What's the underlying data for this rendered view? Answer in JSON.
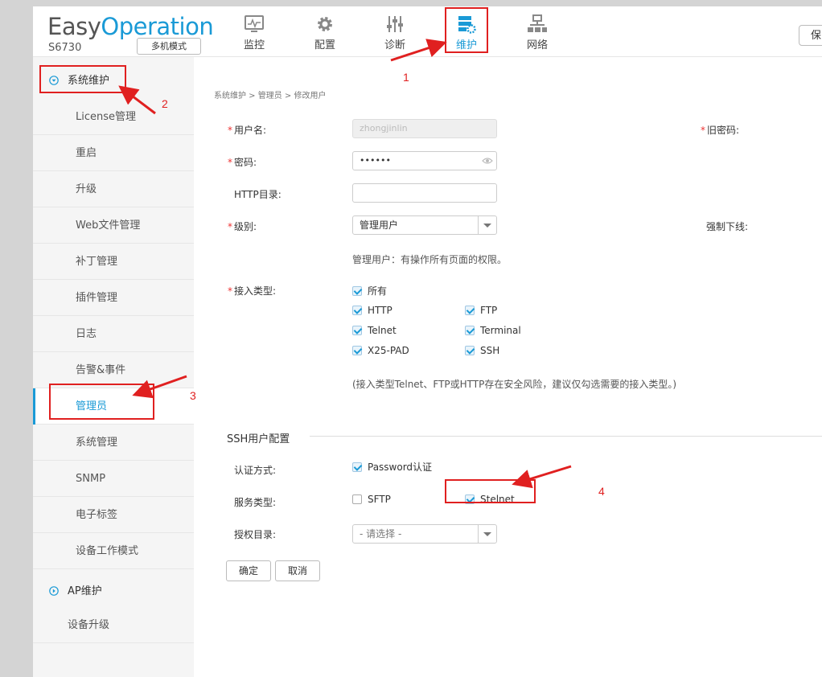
{
  "header": {
    "logo_easy": "Easy",
    "logo_operation": "Operation",
    "model": "S6730",
    "mode_button": "多机模式",
    "nav": [
      {
        "label": "监控",
        "icon": "monitor-icon"
      },
      {
        "label": "配置",
        "icon": "gear-icon"
      },
      {
        "label": "诊断",
        "icon": "diagnose-sliders-icon"
      },
      {
        "label": "维护",
        "icon": "maintenance-server-icon",
        "active": true
      },
      {
        "label": "网络",
        "icon": "network-topology-icon"
      }
    ],
    "save_button": "保"
  },
  "sidebar": {
    "group_system": "系统维护",
    "items": [
      "License管理",
      "重启",
      "升级",
      "Web文件管理",
      "补丁管理",
      "插件管理",
      "日志",
      "告警&事件",
      "管理员",
      "系统管理",
      "SNMP",
      "电子标签",
      "设备工作模式"
    ],
    "active_item": "管理员",
    "group_ap": "AP维护",
    "device_upgrade": "设备升级"
  },
  "breadcrumb": "系统维护 > 管理员 > 修改用户",
  "form": {
    "username_label": "用户名:",
    "username_value": "zhongjinlin",
    "old_password_label": "旧密码:",
    "password_label": "密码:",
    "password_value": "••••••",
    "http_dir_label": "HTTP目录:",
    "http_dir_value": "",
    "level_label": "级别:",
    "level_value": "管理用户",
    "force_offline_label": "强制下线:",
    "level_hint": "管理用户：有操作所有页面的权限。",
    "access_type_label": "接入类型:",
    "access_types": [
      {
        "label": "所有",
        "checked": true
      },
      {
        "label": "HTTP",
        "checked": true
      },
      {
        "label": "FTP",
        "checked": true
      },
      {
        "label": "Telnet",
        "checked": true
      },
      {
        "label": "Terminal",
        "checked": true
      },
      {
        "label": "X25-PAD",
        "checked": true
      },
      {
        "label": "SSH",
        "checked": true
      }
    ],
    "access_hint": "(接入类型Telnet、FTP或HTTP存在安全风险，建议仅勾选需要的接入类型。)"
  },
  "ssh": {
    "section_title": "SSH用户配置",
    "auth_label": "认证方式:",
    "auth_option": "Password认证",
    "service_label": "服务类型:",
    "service_options": [
      {
        "label": "SFTP",
        "checked": false
      },
      {
        "label": "Stelnet",
        "checked": true
      }
    ],
    "auth_dir_label": "授权目录:",
    "auth_dir_value": "- 请选择 -"
  },
  "actions": {
    "confirm": "确定",
    "cancel": "取消"
  },
  "annotations": [
    "1",
    "2",
    "3",
    "4"
  ],
  "colors": {
    "accent": "#1a9ad6",
    "annotation_red": "#e02020"
  }
}
